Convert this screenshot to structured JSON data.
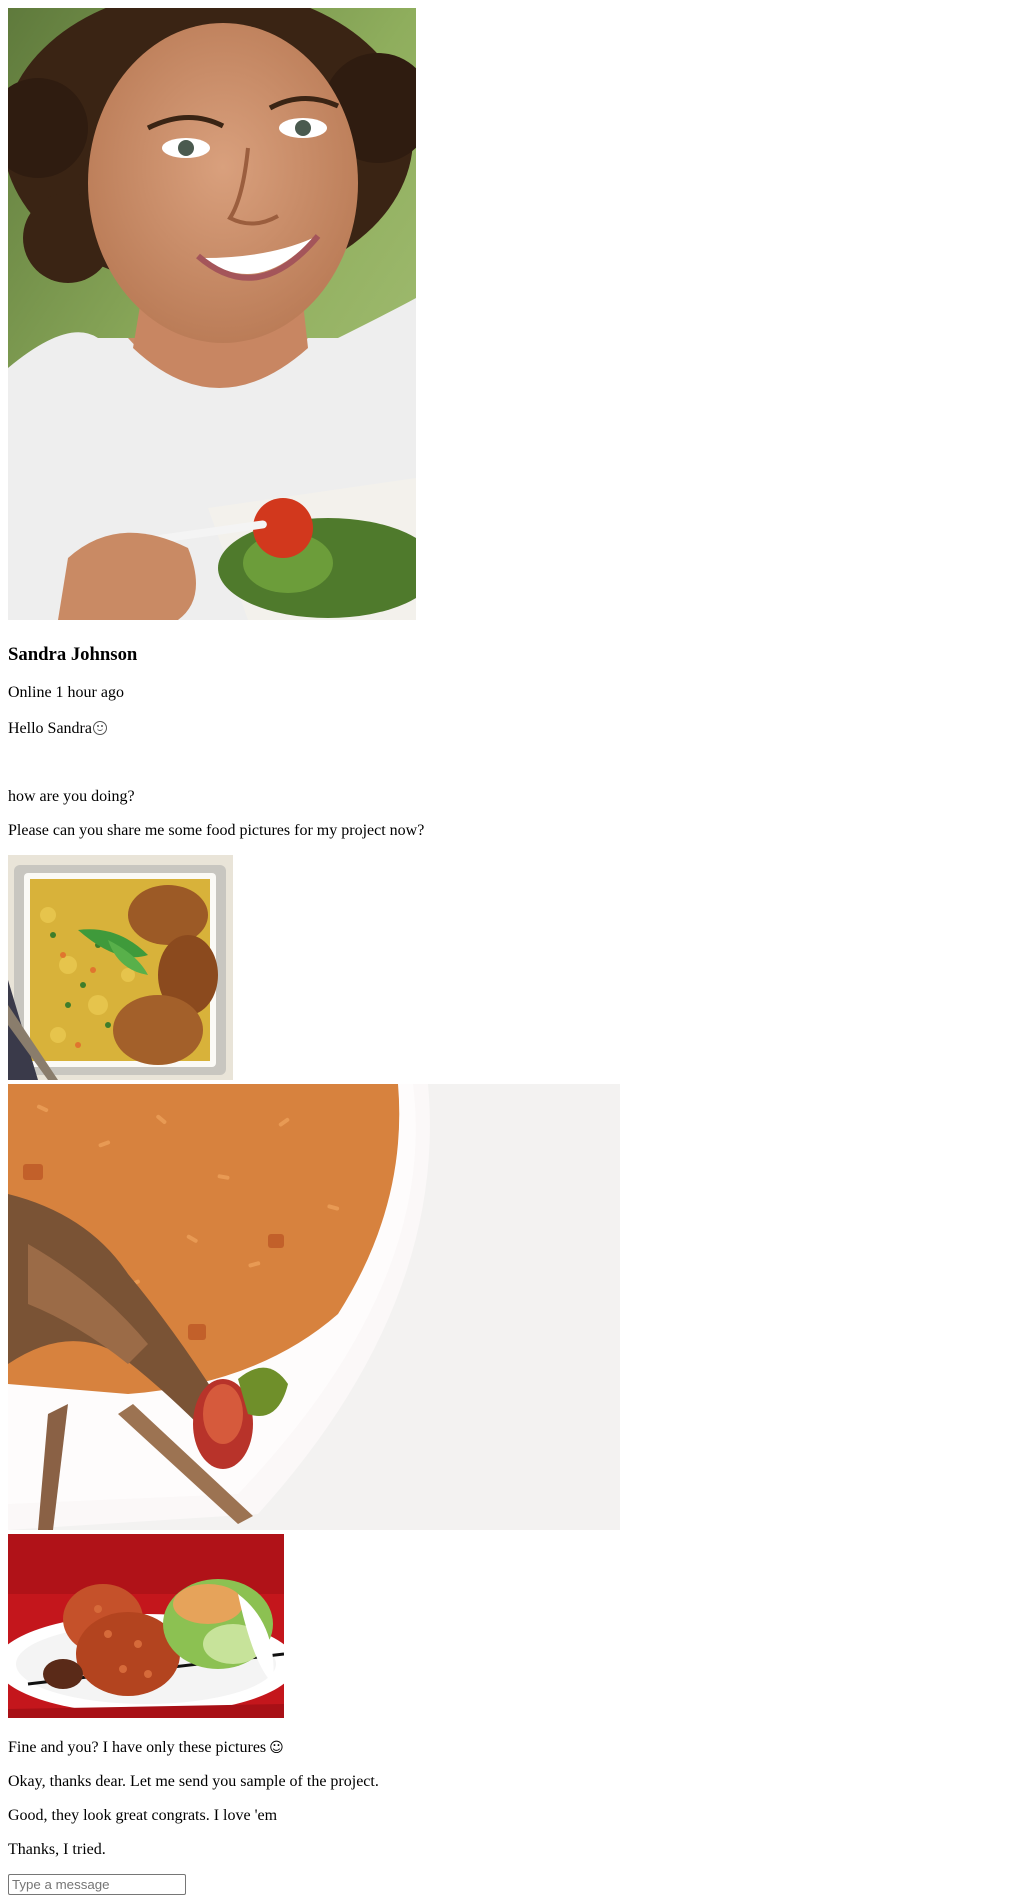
{
  "profile": {
    "photo_alt": "profile photo",
    "name": "Sandra Johnson",
    "status": "Online 1 hour ago"
  },
  "messages": [
    {
      "text": "Hello Sandra",
      "emoji": "smile-face-icon"
    },
    {
      "text": "how are you doing?"
    },
    {
      "text": "Please can you share me some food pictures for my project now?"
    }
  ],
  "shared_images": [
    {
      "icon": "food-photo-rice-chicken-tray"
    },
    {
      "icon": "food-photo-jollof-rice-plate"
    },
    {
      "icon": "food-photo-jollof-rice-salad"
    }
  ],
  "replies": [
    {
      "text": "Fine and you? I have only these pictures",
      "emoji": "☺"
    },
    {
      "text": "Okay, thanks dear. Let me send you sample of the project."
    },
    {
      "text": "Good, they look great congrats. I love 'em"
    },
    {
      "text": "Thanks, I tried."
    }
  ],
  "composer": {
    "placeholder": "Type a message"
  }
}
